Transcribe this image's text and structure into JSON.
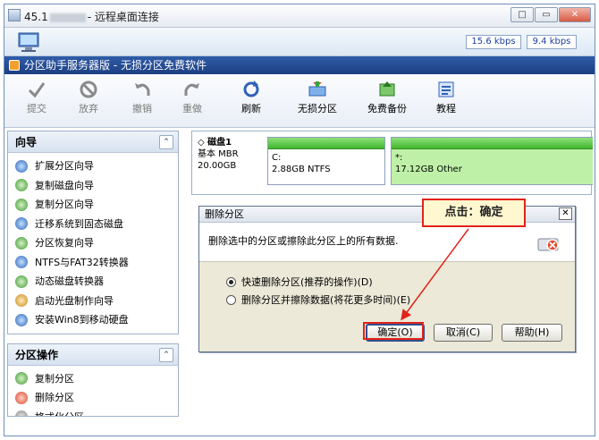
{
  "rdp": {
    "title_prefix": "45.1",
    "title_suffix": "- 远程桌面连接",
    "speed_left": "15.6 kbps",
    "speed_right": "9.4 kbps",
    "controls": [
      "□",
      "▭",
      "✕"
    ]
  },
  "app": {
    "title": "分区助手服务器版 - 无损分区免费软件"
  },
  "toolbar": {
    "items": [
      {
        "label": "提交",
        "icon": "check-icon",
        "disabled": true
      },
      {
        "label": "放弃",
        "icon": "discard-icon",
        "disabled": true
      },
      {
        "label": "撤销",
        "icon": "undo-icon",
        "disabled": true
      },
      {
        "label": "重做",
        "icon": "redo-icon",
        "disabled": true
      },
      {
        "label": "刷新",
        "icon": "refresh-icon",
        "disabled": false
      },
      {
        "label": "无损分区",
        "icon": "partition-icon",
        "disabled": false
      },
      {
        "label": "免费备份",
        "icon": "backup-icon",
        "disabled": false
      },
      {
        "label": "教程",
        "icon": "tutorial-icon",
        "disabled": false
      }
    ]
  },
  "wizard_panel": {
    "title": "向导",
    "items": [
      "扩展分区向导",
      "复制磁盘向导",
      "复制分区向导",
      "迁移系统到固态磁盘",
      "分区恢复向导",
      "NTFS与FAT32转换器",
      "动态磁盘转换器",
      "启动光盘制作向导",
      "安装Win8到移动硬盘"
    ]
  },
  "partition_panel": {
    "title": "分区操作",
    "items": [
      "复制分区",
      "删除分区",
      "格式化分区"
    ]
  },
  "disk": {
    "name": "磁盘1",
    "type": "基本 MBR",
    "size": "20.00GB",
    "partitions": [
      {
        "label": "C:",
        "detail": "2.88GB NTFS"
      },
      {
        "label": "*:",
        "detail": "17.12GB Other"
      }
    ]
  },
  "dialog": {
    "title": "删除分区",
    "message": "删除选中的分区或擦除此分区上的所有数据.",
    "option_fast": "快速删除分区(推荐的操作)(D)",
    "option_wipe": "删除分区并擦除数据(将花更多时间)(E)",
    "ok": "确定(O)",
    "cancel": "取消(C)",
    "help": "帮助(H)",
    "close": "✕"
  },
  "annotation": {
    "text": "点击：确定"
  },
  "colors": {
    "accent_red": "#e2231a",
    "partition_green": "#41b62d",
    "app_title_blue": "#1d3f82"
  }
}
